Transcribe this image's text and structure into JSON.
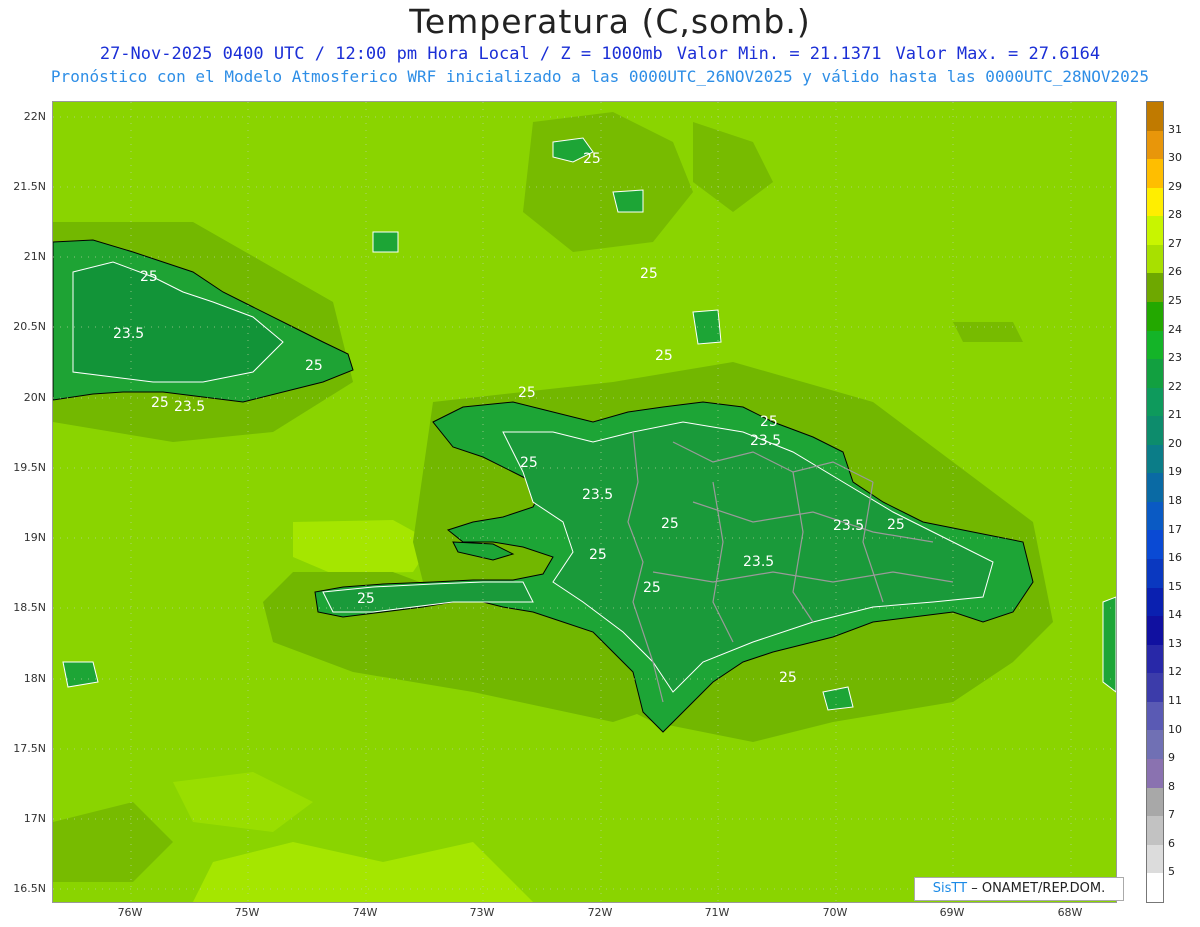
{
  "title": "Temperatura (C,somb.)",
  "subtitle_line1": {
    "datetime": "27-Nov-2025 0400 UTC / 12:00 pm Hora Local / Z = 1000mb",
    "min": "Valor Min. = 21.1371",
    "max": "Valor Max. = 27.6164"
  },
  "subtitle_line2": "Pronóstico con el Modelo Atmosferico WRF inicializado a las 0000UTC_26NOV2025 y válido hasta las  0000UTC_28NOV2025",
  "latitude_ticks": [
    "22N",
    "21.5N",
    "21N",
    "20.5N",
    "20N",
    "19.5N",
    "19N",
    "18.5N",
    "18N",
    "17.5N",
    "17N",
    "16.5N"
  ],
  "longitude_ticks": [
    "76W",
    "75W",
    "74W",
    "73W",
    "72W",
    "71W",
    "70W",
    "69W",
    "68W"
  ],
  "colorbar": {
    "labels": [
      "31",
      "30",
      "29",
      "28",
      "27",
      "26",
      "25",
      "24",
      "23",
      "22",
      "21",
      "20",
      "19",
      "18",
      "17",
      "16",
      "15",
      "14",
      "13",
      "12",
      "11",
      "10",
      "9",
      "8",
      "7",
      "6",
      "5"
    ],
    "colors": [
      "#c07a00",
      "#e8960a",
      "#ffbe00",
      "#ffee00",
      "#c8f500",
      "#a8e000",
      "#6ea800",
      "#23a800",
      "#14b428",
      "#12a040",
      "#0e9a5c",
      "#0d8c6c",
      "#0b7d88",
      "#0a6aa4",
      "#0a5ac4",
      "#0a4ad4",
      "#0a38c0",
      "#0a20b0",
      "#1010a0",
      "#2828a8",
      "#3c3caa",
      "#5a5ab4",
      "#7070b4",
      "#8a72b0",
      "#a8a8a8",
      "#c2c2c2",
      "#dcdcdc",
      "#ffffff"
    ]
  },
  "contour_labels": [
    "25",
    "25",
    "25",
    "23.5",
    "25",
    "23.5",
    "25",
    "25",
    "25",
    "23.5",
    "25",
    "23.5",
    "25",
    "25",
    "23.5",
    "25",
    "23.5",
    "25",
    "25",
    "25",
    "25"
  ],
  "credit": {
    "logo": "SisTT",
    "text": "– ONAMET/REP.DOM."
  }
}
